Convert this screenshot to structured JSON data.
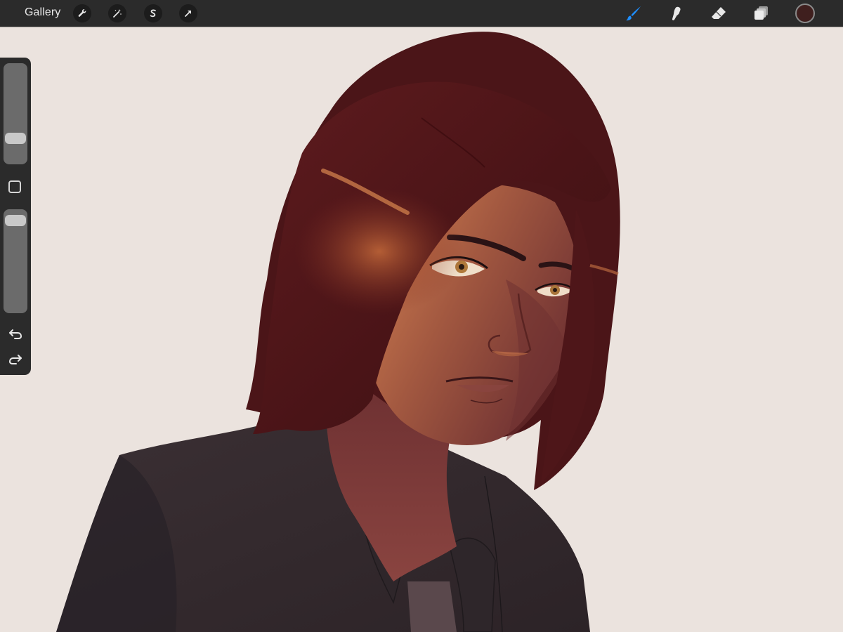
{
  "toolbar": {
    "gallery_label": "Gallery",
    "left_icons": [
      "wrench-icon",
      "magic-wand-icon",
      "selection-icon",
      "transform-arrow-icon"
    ],
    "right_icons": [
      "brush-icon",
      "smudge-icon",
      "eraser-icon",
      "layers-icon"
    ],
    "active_tool": "brush",
    "active_color": "#3f1f1e",
    "accent_color": "#1f8fff"
  },
  "sidebar": {
    "brush_size_level": 0.22,
    "opacity_level": 0.95,
    "icons": [
      "modify-square-icon",
      "undo-icon",
      "redo-icon"
    ]
  },
  "canvas": {
    "background_color": "#ebe3de"
  }
}
